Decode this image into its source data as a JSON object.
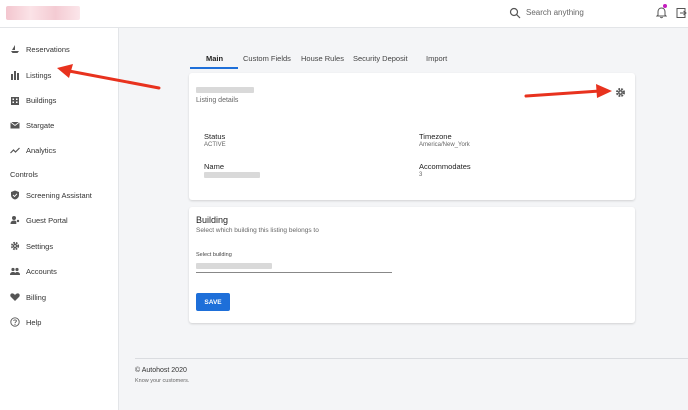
{
  "topbar": {
    "search_placeholder": "Search anything",
    "notification_dot_color": "#c51dbf"
  },
  "sidebar": {
    "items": [
      {
        "label": "Reservations",
        "icon": "boat-icon"
      },
      {
        "label": "Listings",
        "icon": "chart-icon"
      },
      {
        "label": "Buildings",
        "icon": "building-icon"
      },
      {
        "label": "Stargate",
        "icon": "mail-icon"
      },
      {
        "label": "Analytics",
        "icon": "trend-icon"
      }
    ],
    "section_controls": "Controls",
    "controls": [
      {
        "label": "Screening Assistant",
        "icon": "shield-check-icon"
      },
      {
        "label": "Guest Portal",
        "icon": "person-key-icon"
      },
      {
        "label": "Settings",
        "icon": "gear-icon"
      },
      {
        "label": "Accounts",
        "icon": "people-icon"
      },
      {
        "label": "Billing",
        "icon": "heart-icon"
      },
      {
        "label": "Help",
        "icon": "help-circle-icon"
      }
    ]
  },
  "tabs": [
    "Main",
    "Custom Fields",
    "House Rules",
    "Security Deposit",
    "Import"
  ],
  "active_tab": "Main",
  "listing_card": {
    "subtitle": "Listing details",
    "status_label": "Status",
    "status_value": "ACTIVE",
    "timezone_label": "Timezone",
    "timezone_value": "America/New_York",
    "name_label": "Name",
    "accommodates_label": "Accommodates",
    "accommodates_value": "3"
  },
  "building_card": {
    "title": "Building",
    "subtitle": "Select which building this listing belongs to",
    "select_label": "Select building",
    "save_label": "SAVE"
  },
  "footer": {
    "copyright": "© Autohost 2020",
    "tagline": "Know your customers."
  },
  "colors": {
    "accent": "#1e6fd9",
    "annotation_arrow": "#e8321e"
  }
}
